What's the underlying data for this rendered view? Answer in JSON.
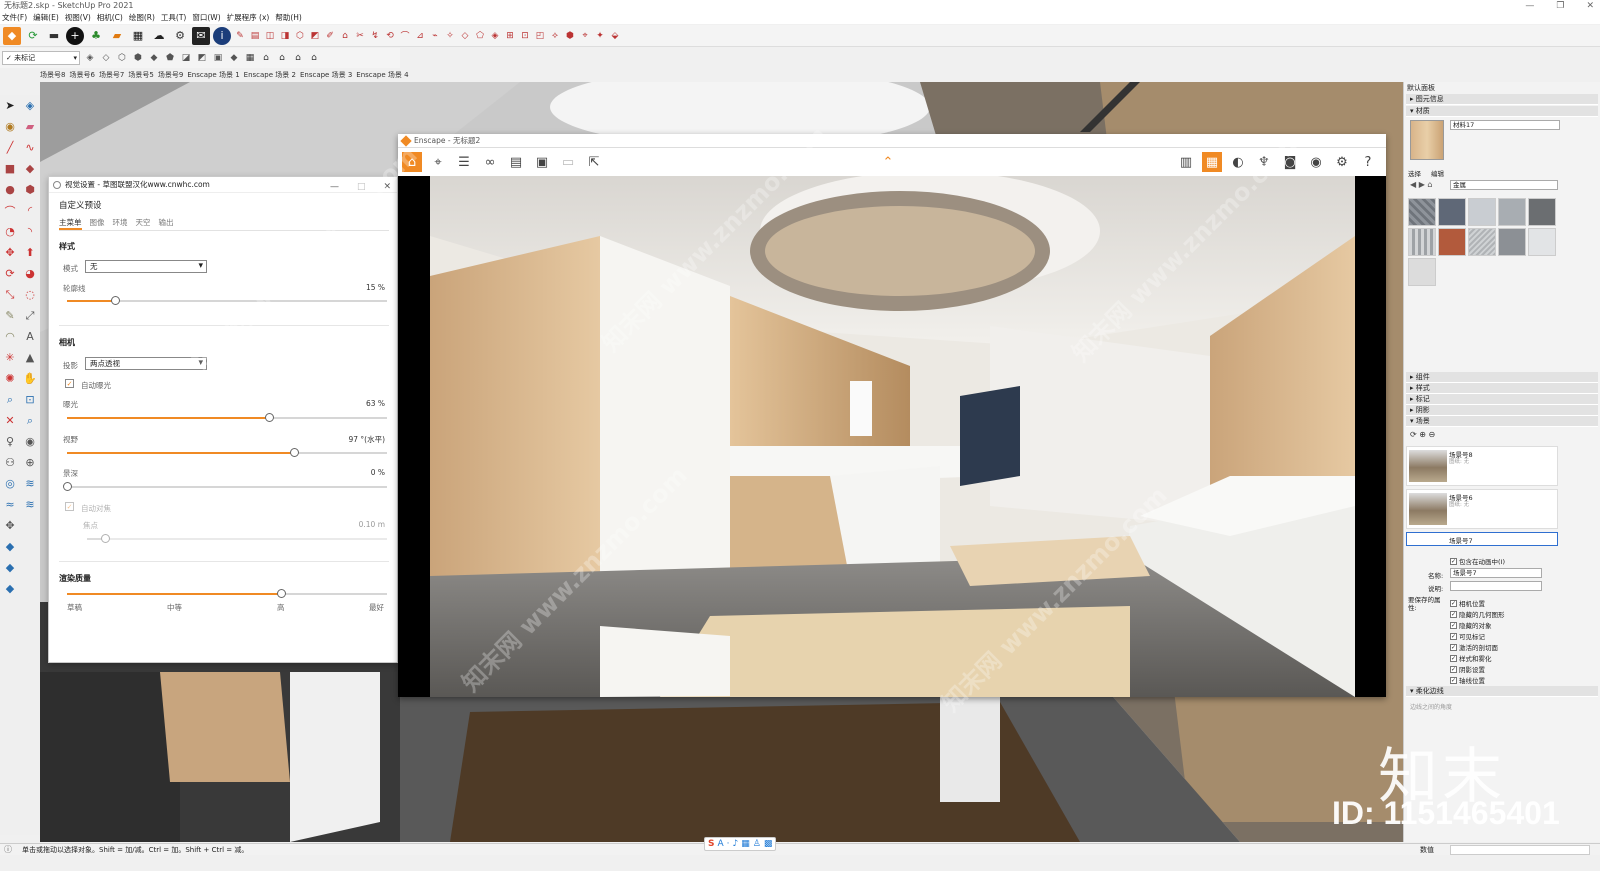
{
  "window": {
    "title": "无标题2.skp - SketchUp Pro 2021"
  },
  "menu": [
    "文件(F)",
    "编辑(E)",
    "视图(V)",
    "相机(C)",
    "绘图(R)",
    "工具(T)",
    "窗口(W)",
    "扩展程序 (x)",
    "帮助(H)"
  ],
  "tag_select": "✓ 未标记",
  "scene_tabs": [
    "场景号8",
    "场景号6",
    "场景号7",
    "场景号5",
    "场景号9",
    "Enscape 场景 1",
    "Enscape 场景 2",
    "Enscape 场景 3",
    "Enscape 场景 4"
  ],
  "status": {
    "hint": "单击或拖动以选择对象。Shift = 加/减。Ctrl = 加。Shift + Ctrl = 减。",
    "measure_label": "数值"
  },
  "visual_settings": {
    "title": "视觉设置 - 草图联盟汉化www.cnwhc.com",
    "preset": "自定义预设",
    "tabs": [
      "主菜单",
      "图像",
      "环境",
      "天空",
      "输出"
    ],
    "style_header": "样式",
    "mode_label": "模式",
    "mode_value": "无",
    "outline_label": "轮廓线",
    "outline_value": "15 %",
    "outline_pct": 15,
    "camera_header": "相机",
    "projection_label": "投影",
    "projection_value": "两点透视",
    "auto_exposure": "自动曝光",
    "exposure_label": "曝光",
    "exposure_value": "63 %",
    "exposure_pct": 63,
    "fov_label": "视野",
    "fov_value": "97 °(水平)",
    "fov_pct": 71,
    "dof_label": "景深",
    "dof_value": "0 %",
    "dof_pct": 0,
    "autofocus": "自动对焦",
    "focus_label": "焦点",
    "focus_value": "0.10 m",
    "focus_pct": 6,
    "quality_header": "渲染质量",
    "quality_levels": [
      "草稿",
      "中等",
      "高",
      "最好"
    ],
    "quality_pct": 67
  },
  "enscape": {
    "title": "Enscape - 无标题2"
  },
  "right_panel": {
    "tray": "默认面板",
    "entity_info": "图元信息",
    "materials": "材质",
    "material_name": "材料17",
    "select_tab": "选择",
    "edit_tab": "编辑",
    "library": "金属",
    "components": "组件",
    "styles": "样式",
    "tags": "标记",
    "shadows": "阴影",
    "scenes": "场景",
    "scenes_list": [
      {
        "name": "场景号8",
        "sub": "图纸: 无"
      },
      {
        "name": "场景号6",
        "sub": "图纸: 无"
      },
      {
        "name": "场景号7",
        "sub": ""
      }
    ],
    "include_anim": "包含在动画中(I)",
    "name_label": "名称:",
    "name_value": "场景号7",
    "desc_label": "说明:",
    "props_label": "要保存的属性:",
    "props": [
      "相机位置",
      "隐藏的几何图形",
      "隐藏的对象",
      "可见标记",
      "激活的剖切面",
      "样式和雾化",
      "阴影设置",
      "轴线位置"
    ],
    "soften": "柔化边线",
    "soften_sub": "边线之间的角度"
  },
  "brand": {
    "logo": "知末",
    "id": "ID: 1151465401"
  },
  "watermark": "知末网 www.znzmo.com",
  "colors": {
    "accent": "#f08a24",
    "enscape_orange": "#f08a24"
  }
}
